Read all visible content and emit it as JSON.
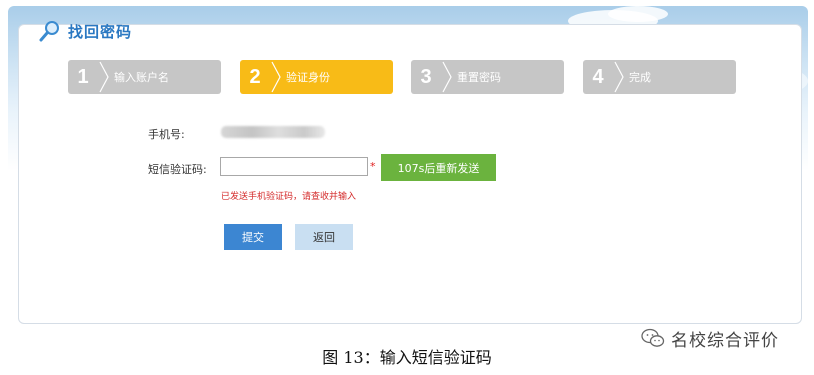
{
  "page": {
    "title": "找回密码"
  },
  "steps": [
    {
      "num": "1",
      "label": "输入账户名",
      "active": false
    },
    {
      "num": "2",
      "label": "验证身份",
      "active": true
    },
    {
      "num": "3",
      "label": "重置密码",
      "active": false
    },
    {
      "num": "4",
      "label": "完成",
      "active": false
    }
  ],
  "form": {
    "phone_label": "手机号:",
    "code_label": "短信验证码:",
    "code_value": "",
    "required_mark": "*",
    "resend_label": "107s后重新发送",
    "hint": "已发送手机验证码，请查收并输入"
  },
  "buttons": {
    "submit": "提交",
    "back": "返回"
  },
  "caption": "图 13：输入短信验证码",
  "watermark": "名校综合评价",
  "colors": {
    "accent_blue": "#3c86d2",
    "step_active": "#f8bb17",
    "step_inactive": "#c6c6c6",
    "resend_green": "#6bb33e",
    "hint_red": "#d42b2b",
    "title_blue": "#2a78c2"
  },
  "icons": {
    "title": "magnifier-icon",
    "watermark": "wechat-icon"
  }
}
